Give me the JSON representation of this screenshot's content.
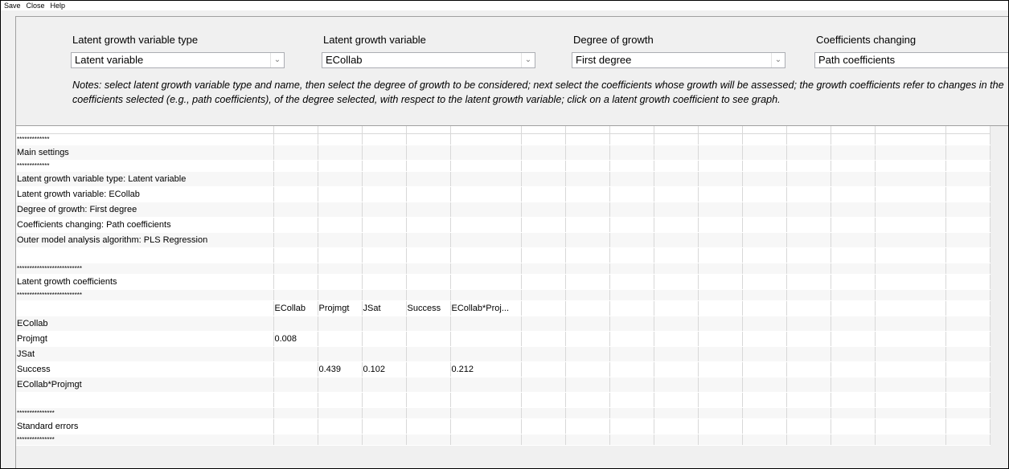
{
  "menu": [
    "Save",
    "Close",
    "Help"
  ],
  "controls": {
    "type": {
      "label": "Latent growth variable type",
      "value": "Latent variable"
    },
    "variable": {
      "label": "Latent growth variable",
      "value": "ECollab"
    },
    "degree": {
      "label": "Degree of growth",
      "value": "First degree"
    },
    "coefficients": {
      "label": "Coefficients changing",
      "value": "Path coefficients"
    }
  },
  "notes": "Notes: select latent growth variable type and name, then select the degree of growth to be considered; next select the coefficients whose growth will be assessed; the growth coefficients refer to changes in the coefficients selected (e.g., path coefficients), of the degree selected, with respect to the latent growth variable; click on a latent growth coefficient to see graph.",
  "grid": {
    "rows": [
      [
        "*************",
        "",
        "",
        "",
        "",
        ""
      ],
      [
        "Main settings",
        "",
        "",
        "",
        "",
        ""
      ],
      [
        "*************",
        "",
        "",
        "",
        "",
        ""
      ],
      [
        "Latent growth variable type: Latent variable",
        "",
        "",
        "",
        "",
        ""
      ],
      [
        "Latent growth variable: ECollab",
        "",
        "",
        "",
        "",
        ""
      ],
      [
        "Degree of growth: First degree",
        "",
        "",
        "",
        "",
        ""
      ],
      [
        "Coefficients changing: Path coefficients",
        "",
        "",
        "",
        "",
        ""
      ],
      [
        "Outer model analysis algorithm: PLS Regression",
        "",
        "",
        "",
        "",
        ""
      ],
      [
        "",
        "",
        "",
        "",
        "",
        ""
      ],
      [
        "**************************",
        "",
        "",
        "",
        "",
        ""
      ],
      [
        "Latent growth coefficients",
        "",
        "",
        "",
        "",
        ""
      ],
      [
        "**************************",
        "",
        "",
        "",
        "",
        ""
      ],
      [
        "",
        "ECollab",
        "Projmgt",
        "JSat",
        "Success",
        "ECollab*Proj..."
      ],
      [
        "ECollab",
        "",
        "",
        "",
        "",
        ""
      ],
      [
        "Projmgt",
        "0.008",
        "",
        "",
        "",
        ""
      ],
      [
        "JSat",
        "",
        "",
        "",
        "",
        ""
      ],
      [
        "Success",
        "",
        "0.439",
        "0.102",
        "",
        "0.212"
      ],
      [
        "ECollab*Projmgt",
        "",
        "",
        "",
        "",
        ""
      ],
      [
        "",
        "",
        "",
        "",
        "",
        ""
      ],
      [
        "***************",
        "",
        "",
        "",
        "",
        ""
      ],
      [
        "Standard errors",
        "",
        "",
        "",
        "",
        ""
      ],
      [
        "***************",
        "",
        "",
        "",
        "",
        ""
      ]
    ]
  }
}
